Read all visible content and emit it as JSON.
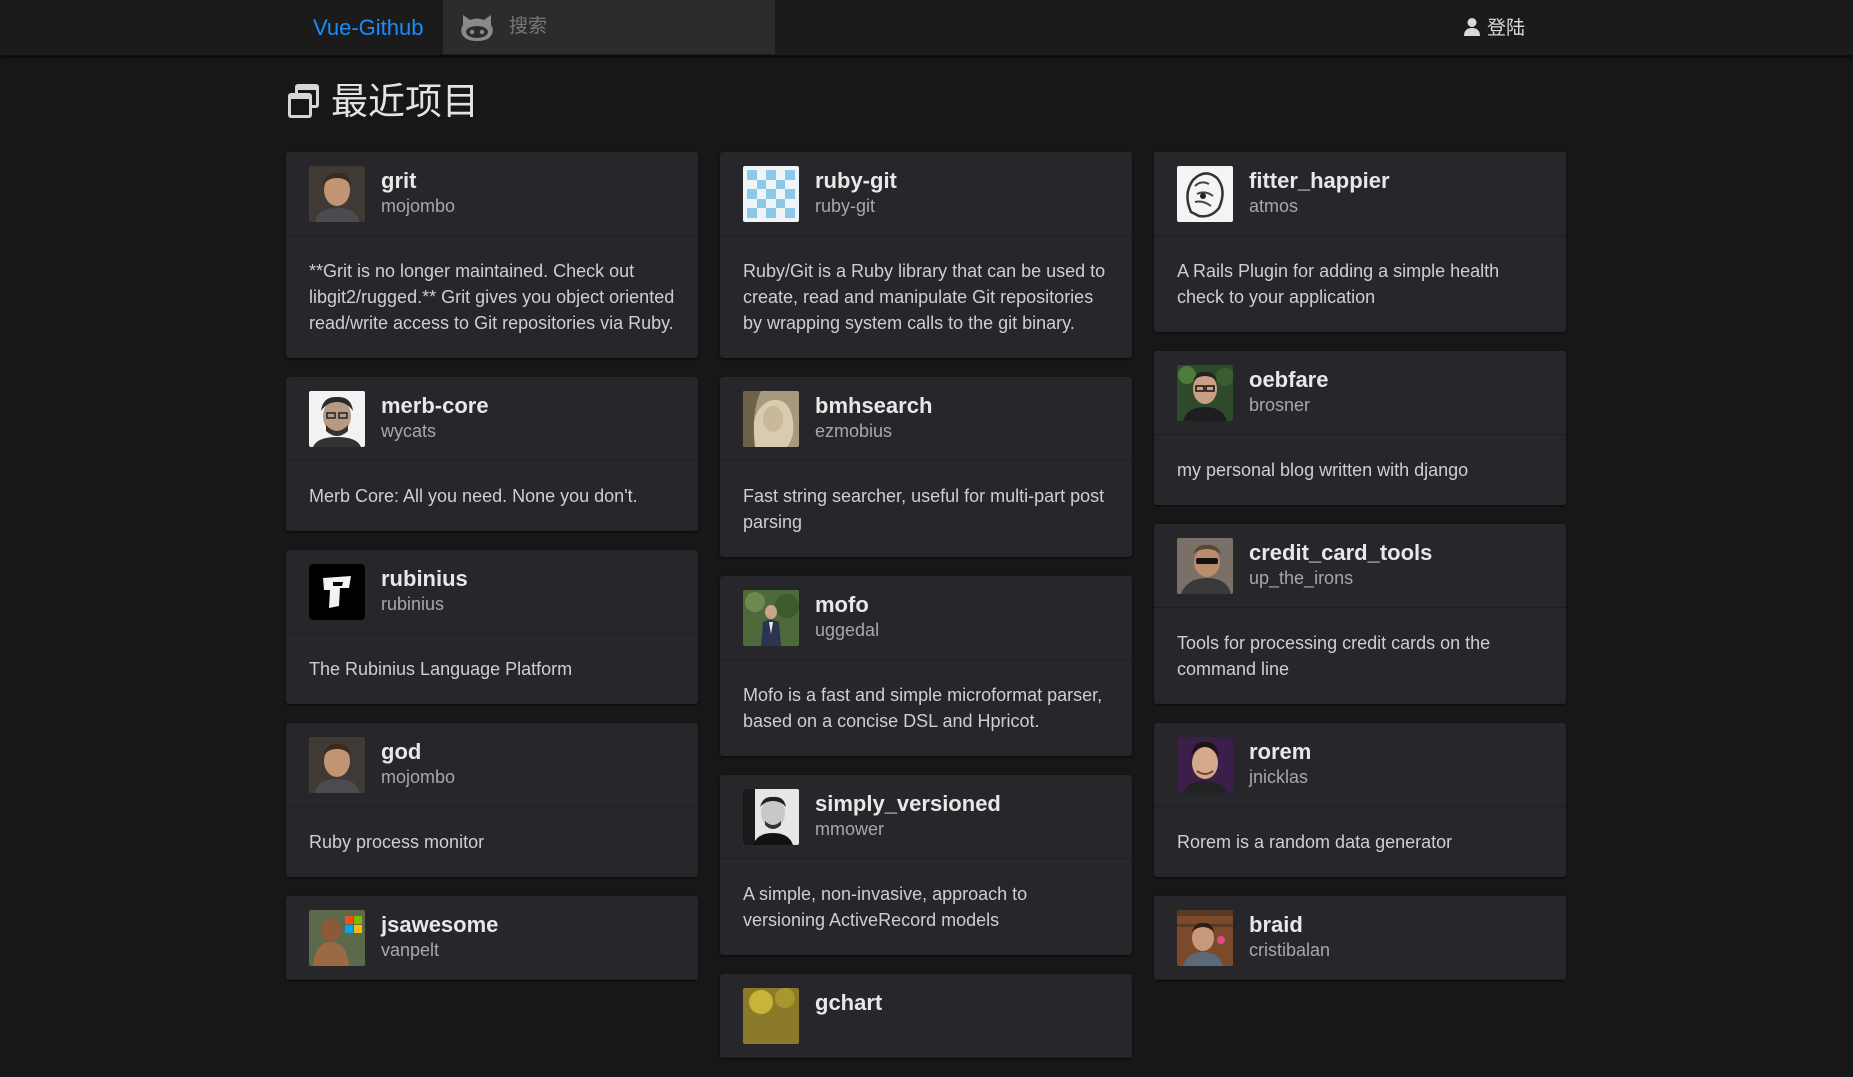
{
  "nav": {
    "brand": "Vue-Github",
    "search_placeholder": "搜索",
    "login_label": "登陆",
    "github_icon": "github-octocat-icon",
    "user_icon": "user-icon"
  },
  "page": {
    "title": "最近项目",
    "title_icon": "window-restore-icon"
  },
  "colors": {
    "accent": "#1a8cff",
    "background": "#171717",
    "card": "#26262b"
  },
  "columns": [
    [
      {
        "name": "grit",
        "owner": "mojombo",
        "description": "**Grit is no longer maintained. Check out libgit2/rugged.** Grit gives you object oriented read/write access to Git repositories via Ruby.",
        "avatar": "mojombo-photo"
      },
      {
        "name": "merb-core",
        "owner": "wycats",
        "description": "Merb Core: All you need. None you don't.",
        "avatar": "wycats-photo"
      },
      {
        "name": "rubinius",
        "owner": "rubinius",
        "description": "The Rubinius Language Platform",
        "avatar": "rubinius-logo"
      },
      {
        "name": "god",
        "owner": "mojombo",
        "description": "Ruby process monitor",
        "avatar": "mojombo-photo"
      },
      {
        "name": "jsawesome",
        "owner": "vanpelt",
        "description": "",
        "avatar": "vanpelt-photo"
      }
    ],
    [
      {
        "name": "ruby-git",
        "owner": "ruby-git",
        "description": "Ruby/Git is a Ruby library that can be used to create, read and manipulate Git repositories by wrapping system calls to the git binary.",
        "avatar": "ruby-git-identicon"
      },
      {
        "name": "bmhsearch",
        "owner": "ezmobius",
        "description": "Fast string searcher, useful for multi-part post parsing",
        "avatar": "ezmobius-photo"
      },
      {
        "name": "mofo",
        "owner": "uggedal",
        "description": "Mofo is a fast and simple microformat parser, based on a concise DSL and Hpricot.",
        "avatar": "uggedal-photo"
      },
      {
        "name": "simply_versioned",
        "owner": "mmower",
        "description": "A simple, non-invasive, approach to versioning ActiveRecord models",
        "avatar": "mmower-photo"
      },
      {
        "name": "gchart",
        "owner": "",
        "description": "",
        "avatar": "gchart-photo"
      }
    ],
    [
      {
        "name": "fitter_happier",
        "owner": "atmos",
        "description": "A Rails Plugin for adding a simple health check to your application",
        "avatar": "atmos-sketch"
      },
      {
        "name": "oebfare",
        "owner": "brosner",
        "description": "my personal blog written with django",
        "avatar": "brosner-photo"
      },
      {
        "name": "credit_card_tools",
        "owner": "up_the_irons",
        "description": "Tools for processing credit cards on the command line",
        "avatar": "up-the-irons-photo"
      },
      {
        "name": "rorem",
        "owner": "jnicklas",
        "description": "Rorem is a random data generator",
        "avatar": "jnicklas-photo"
      },
      {
        "name": "braid",
        "owner": "cristibalan",
        "description": "",
        "avatar": "cristibalan-photo"
      }
    ]
  ]
}
